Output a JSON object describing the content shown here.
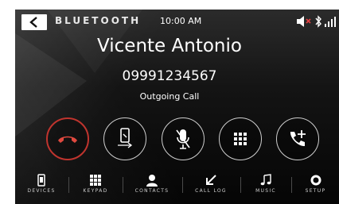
{
  "header": {
    "source_title": "BLUETOOTH",
    "time": "10:00 AM",
    "back_icon": "chevron-left-icon",
    "status_icons": [
      "speaker-muted-icon",
      "bluetooth-icon",
      "signal-bars-icon"
    ]
  },
  "call": {
    "caller_name": "Vicente Antonio",
    "caller_number": "09991234567",
    "status": "Outgoing Call"
  },
  "call_controls": [
    {
      "name": "end-call-button",
      "icon": "phone-hangup-icon",
      "color": "#c0342e"
    },
    {
      "name": "transfer-to-phone-button",
      "icon": "phone-transfer-icon"
    },
    {
      "name": "mute-mic-button",
      "icon": "mic-muted-icon"
    },
    {
      "name": "keypad-button",
      "icon": "keypad-icon"
    },
    {
      "name": "add-call-button",
      "icon": "phone-add-icon"
    }
  ],
  "nav": {
    "devices": "DEVICES",
    "keypad": "KEYPAD",
    "contacts": "CONTACTS",
    "call_log": "CALL LOG",
    "music": "MUSIC",
    "setup": "SETUP"
  },
  "colors": {
    "end_call_ring": "#c0342e",
    "background": "#101010",
    "text": "#ffffff"
  }
}
